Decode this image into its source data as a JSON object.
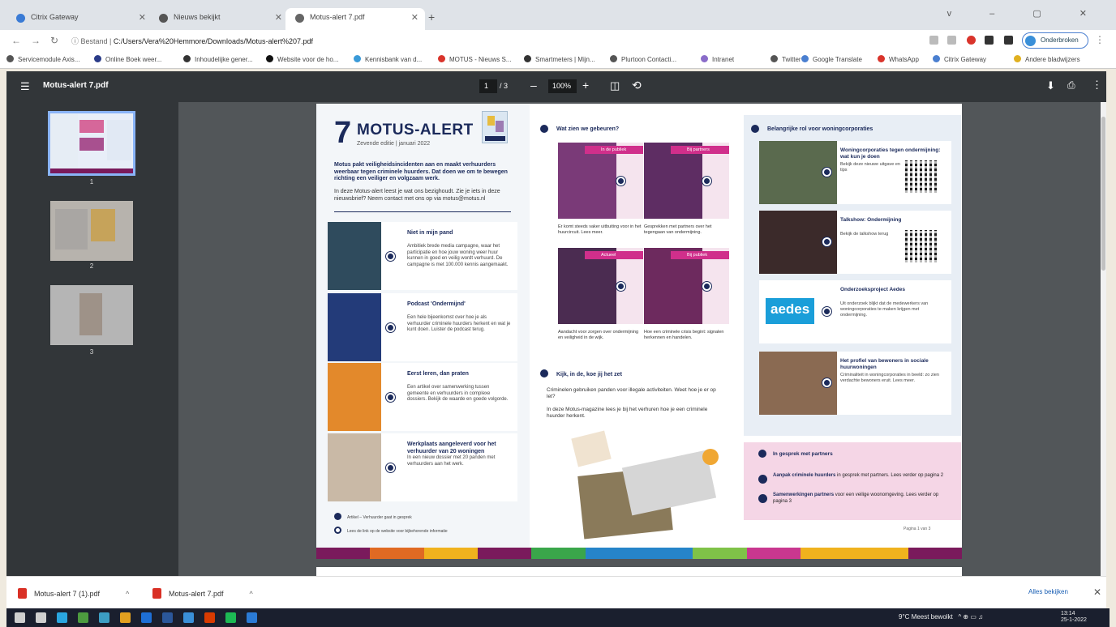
{
  "browser": {
    "tabs": [
      {
        "label": "Citrix Gateway",
        "active": false
      },
      {
        "label": "Nieuws bekijkt",
        "active": false
      },
      {
        "label": "Motus-alert 7.pdf",
        "active": true
      }
    ],
    "new_tab": "+",
    "window_controls": "v – ▢ ✕",
    "address": {
      "prefix": "Bestand",
      "path": "C:/Users/Vera%20Hemmore/Downloads/Motus-alert%207.pdf"
    },
    "pause_label": "Onderbroken",
    "bookmarks": [
      "Servicemodule Axis...",
      "Online Boek weer...",
      "Inhoudelijke gener...",
      "Website voor de ho...",
      "Kennisbank van d...",
      "MOTUS - Nieuws S...",
      "Smartmeters | Mijn...",
      "Plurtoon Contacti...",
      "Intranet",
      "Twitter",
      "Google Translate",
      "WhatsApp",
      "Citrix Gateway",
      "Andere bladwijzers"
    ]
  },
  "pdf_viewer": {
    "filename": "Motus-alert 7.pdf",
    "page_current": "1",
    "page_total": "/ 3",
    "zoom": "100%",
    "zoom_minus": "–",
    "zoom_plus": "+",
    "menu_icon": "☰",
    "thumb_labels": [
      "1",
      "2",
      "3"
    ]
  },
  "document": {
    "number": "7",
    "title": "MOTUS-ALERT",
    "edition": "Zevende editie | januari 2022",
    "intro_bold": "Motus pakt veiligheidsincidenten aan en maakt verhuurders weerbaar tegen criminele huurders. Dat doen we om te bewegen richting een veiliger en volgzaam werk.",
    "intro_regular": "In deze Motus-alert leest je wat ons bezighoudt. Zie je iets in deze nieuwsbrief? Neem contact met ons op via motus@motus.nl",
    "stories": [
      {
        "title": "Niet in mijn pand",
        "text": "Ambitiek brede media campagne, waar het participatie en hoe jouw woning weer huur kunnen in goed en veilig wordt verhuurd. De campagne is met 100.000 kennis aangemaakt.",
        "img": "#2f4b5d"
      },
      {
        "title": "Podcast 'Ondermijnd'",
        "text": "Een hele bijeenkomst over hoe je als verhuurder criminele huurders herkent en wat je kunt doen. Luister de podcast terug.",
        "img": "#233b79"
      },
      {
        "title": "Eerst leren, dan praten",
        "text": "Een artikel over samenwerking tussen gemeente en verhuurders in complexe dossiers. Bekijk de waarde en goede volgorde.",
        "img": "#e3892b"
      },
      {
        "title": "Werkplaats aangeleverd voor het verhuurder van 20 woningen",
        "text": "In een nieuw dossier met 20 panden met verhuurders aan het werk.",
        "img": "#c9b9a6"
      }
    ],
    "legend": [
      "Artikel – Verhuurder gaat in gesprek",
      "Lees de link op de website voor bijbehorende informatie"
    ],
    "happened": {
      "heading": "Wat zien we gebeuren?",
      "items": [
        {
          "tag": "In de publiek",
          "caption": "Er komt steeds vaker uitbuiting voor in het huurcircuit. Lees meer.",
          "img": "#7a3a78"
        },
        {
          "tag": "Bij partners",
          "caption": "Gesprekken met partners over het tegengaan van ondermijning.",
          "img": "#5e2d63"
        },
        {
          "tag": "Actueel",
          "caption": "Aandacht voor zorgen over ondermijning en veiligheid in de wijk.",
          "img": "#4b2c51"
        },
        {
          "tag": "Bij publiek",
          "caption": "Hoe een criminele crisis begint: signalen herkennen en handelen.",
          "img": "#6d2a5e"
        }
      ]
    },
    "ad": {
      "heading": "Kijk, in de, koe jij het zet",
      "text1": "Criminelen gebruiken panden voor illegale activiteiten. Weet hoe je er op let?",
      "text2": "In deze Motus-magazine lees je bij het verhuren hoe je een criminele huurder herkent."
    },
    "partners_section": {
      "heading": "Belangrijke rol voor woningcorporaties",
      "items": [
        {
          "title": "Woningcorporaties tegen ondermijning: wat kun je doen",
          "text": "Bekijk deze nieuwe uitgave en tips",
          "img": "#5a6a4e",
          "qr": true
        },
        {
          "title": "Talkshow: Ondermijning",
          "text": "Bekijk de talkshow terug",
          "img": "#3b2a2a",
          "qr": true
        },
        {
          "title": "Onderzoeksproject Aedes",
          "text": "Uit onderzoek blijkt dat de medewerkers van woningcorporaties te maken krijgen met ondermijning.",
          "img": "#1a9ed9",
          "logo": "aedes"
        },
        {
          "title": "Het profiel van bewoners in sociale huurwoningen",
          "text": "Criminaliteit in woningcorporaties in beeld: zo zien verdachte bewoners eruit. Lees meer.",
          "img": "#8a6a52"
        }
      ]
    },
    "in_conversation": {
      "heading": "In gesprek met partners",
      "items": [
        {
          "bold": "Aanpak criminele huurders",
          "rest": "in gesprek met partners. Lees verder op pagina 2"
        },
        {
          "bold": "Samenwerkingen partners",
          "rest": "voor een veilige woonomgeving. Lees verder op pagina 3"
        }
      ]
    },
    "page_indicator": "Pagina 1 van 3",
    "stripe_colors": [
      "#7a1a5c",
      "#e06a23",
      "#f0b21e",
      "#7a1a5c",
      "#3aa64a",
      "#2684c9",
      "#2684c9",
      "#7fc248",
      "#c9378f",
      "#f0b21e",
      "#f0b21e",
      "#7a1a5c"
    ]
  },
  "downloads": {
    "items": [
      "Motus-alert 7 (1).pdf",
      "Motus-alert 7.pdf"
    ],
    "show_all": "Alles bekijken",
    "close": "✕"
  },
  "taskbar": {
    "weather": "9°C Meest bewolkt",
    "time": "13:14",
    "date": "25-1-2022",
    "app_colors": [
      "#cfcfcf",
      "#cfcfcf",
      "#2aa6e0",
      "#4d9b3f",
      "#3c9ec4",
      "#e2a020",
      "#1e6fd6",
      "#2b579a",
      "#3a8fd8",
      "#d83b01",
      "#1db954",
      "#2b7bd6"
    ]
  }
}
